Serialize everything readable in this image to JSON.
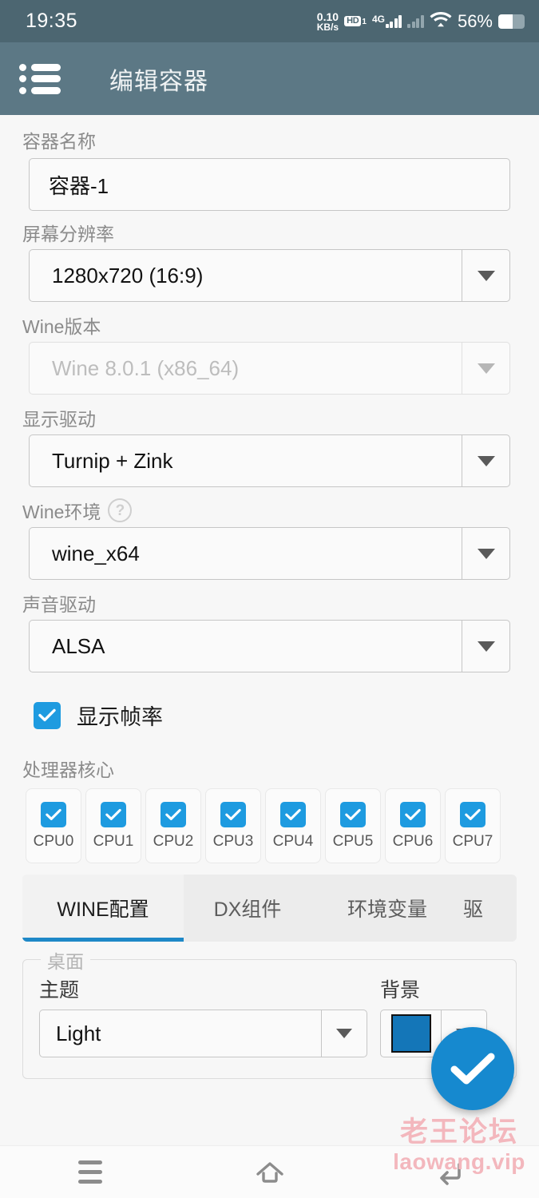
{
  "status_bar": {
    "time": "19:35",
    "net_speed_value": "0.10",
    "net_speed_unit": "KB/s",
    "hd_label": "HD",
    "hd_sub": "1",
    "network_type": "4G",
    "battery_percent": "56%",
    "battery_level": 56,
    "icons": [
      "hd-icon",
      "signal-icon",
      "signal-secondary-icon",
      "wifi-icon",
      "battery-icon"
    ]
  },
  "app_bar": {
    "menu_icon": "list-menu-icon",
    "title": "编辑容器"
  },
  "form": {
    "container_name": {
      "label": "容器名称",
      "value": "容器-1"
    },
    "screen_resolution": {
      "label": "屏幕分辨率",
      "value": "1280x720 (16:9)",
      "enabled": true
    },
    "wine_version": {
      "label": "Wine版本",
      "value": "Wine 8.0.1 (x86_64)",
      "enabled": false
    },
    "graphics_driver": {
      "label": "显示驱动",
      "value": "Turnip + Zink",
      "enabled": true
    },
    "wine_prefix": {
      "label": "Wine环境",
      "help_icon": "help-circle-icon",
      "value": "wine_x64",
      "enabled": true
    },
    "audio_driver": {
      "label": "声音驱动",
      "value": "ALSA",
      "enabled": true
    },
    "show_fps": {
      "label": "显示帧率",
      "checked": true
    },
    "cpu_cores": {
      "label": "处理器核心",
      "items": [
        {
          "label": "CPU0",
          "checked": true
        },
        {
          "label": "CPU1",
          "checked": true
        },
        {
          "label": "CPU2",
          "checked": true
        },
        {
          "label": "CPU3",
          "checked": true
        },
        {
          "label": "CPU4",
          "checked": true
        },
        {
          "label": "CPU5",
          "checked": true
        },
        {
          "label": "CPU6",
          "checked": true
        },
        {
          "label": "CPU7",
          "checked": true
        }
      ]
    }
  },
  "tabs": {
    "items": [
      {
        "label": "WINE配置",
        "active": true
      },
      {
        "label": "DX组件",
        "active": false
      },
      {
        "label": "环境变量",
        "active": false
      },
      {
        "label": "驱",
        "active": false
      }
    ],
    "active_indicator_color": "#1e88c7"
  },
  "desktop_section": {
    "legend": "桌面",
    "theme": {
      "label": "主题",
      "value": "Light"
    },
    "background": {
      "label": "背景",
      "color": "#1476b8"
    }
  },
  "fab": {
    "name": "confirm-fab",
    "icon": "check-icon",
    "color": "#1689cf"
  },
  "watermark": {
    "line1": "老王论坛",
    "line2": "laowang.vip",
    "color": "#f3b7bd"
  },
  "nav_bar": {
    "recent_icon": "recents-icon",
    "home_icon": "home-icon",
    "back_icon": "back-icon"
  },
  "colors": {
    "status_bar_bg": "#4c6671",
    "app_bar_bg": "#5c7885",
    "page_bg": "#f7f7f7",
    "accent": "#1e9be0",
    "checkbox": "#1e9be0"
  }
}
